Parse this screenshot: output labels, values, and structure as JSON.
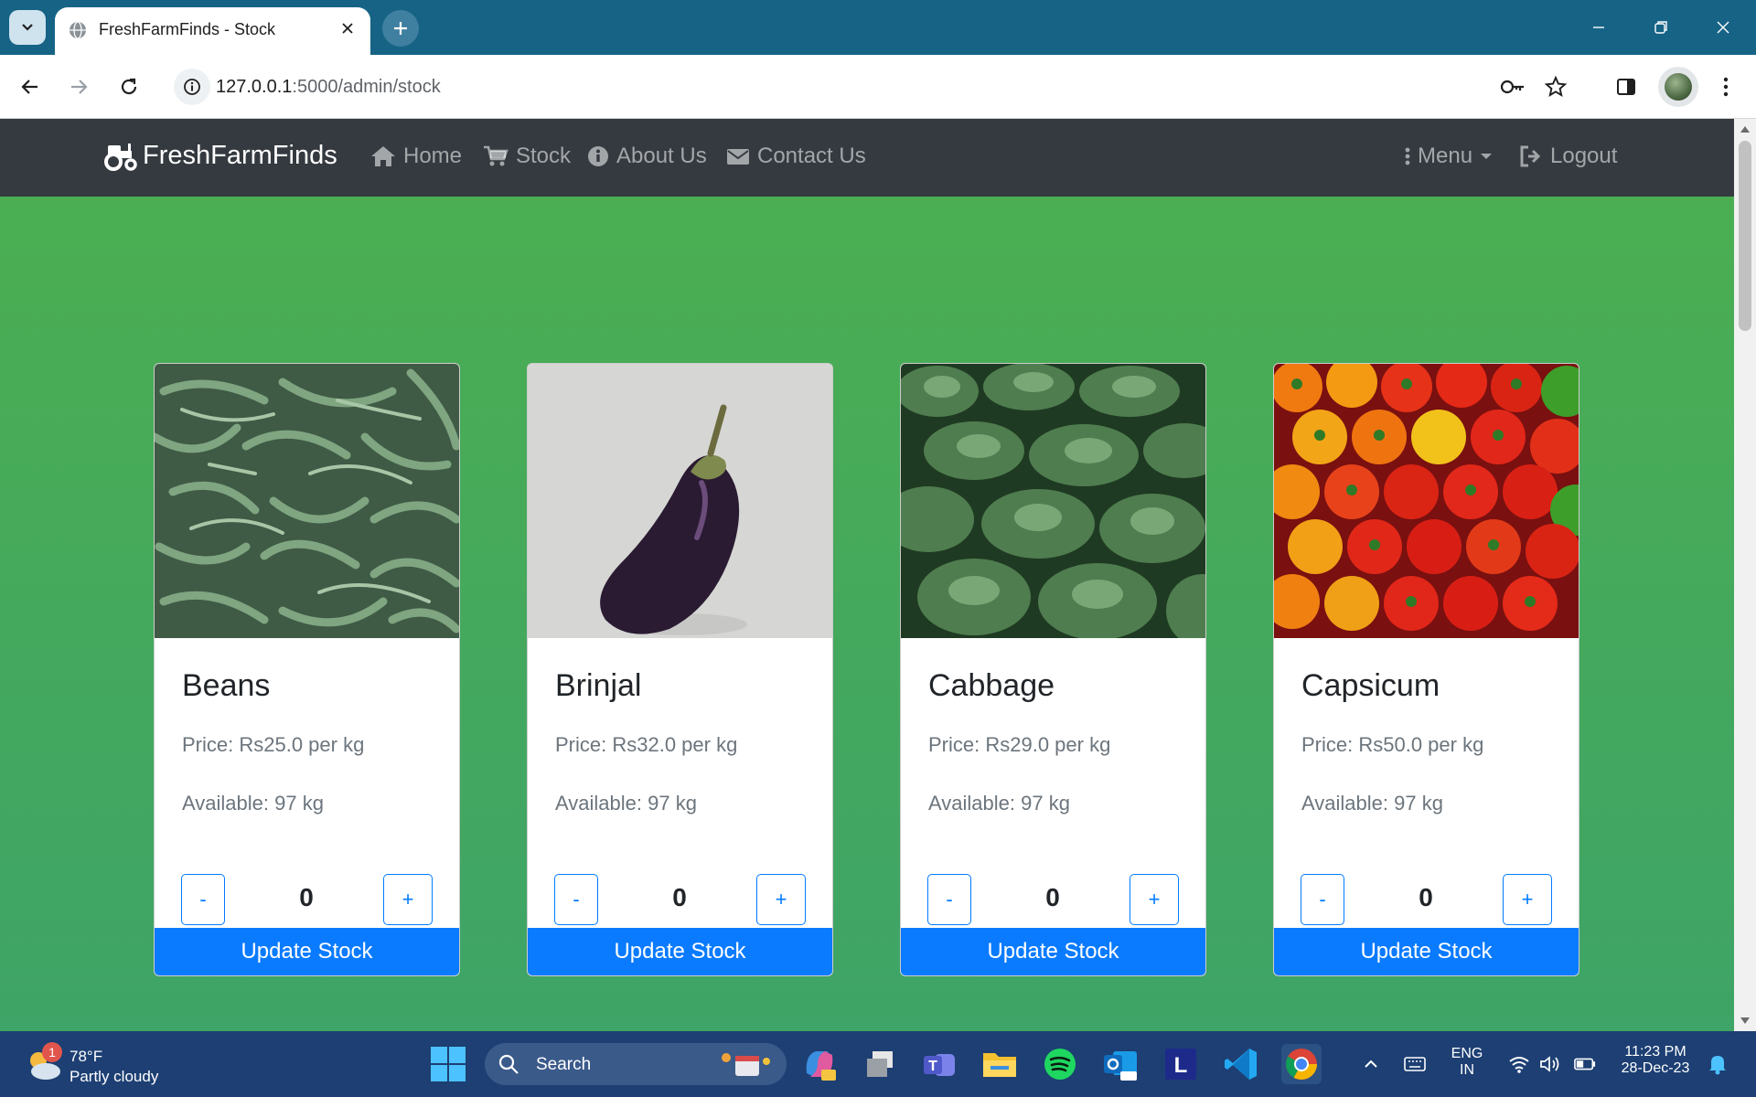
{
  "browser": {
    "tab_title": "FreshFarmFinds - Stock",
    "url_host": "127.0.0.1",
    "url_path": ":5000/admin/stock"
  },
  "navbar": {
    "brand": "FreshFarmFinds",
    "links": [
      {
        "label": "Home",
        "icon": "home-icon"
      },
      {
        "label": "Stock",
        "icon": "cart-icon"
      },
      {
        "label": "About Us",
        "icon": "info-icon"
      },
      {
        "label": "Contact Us",
        "icon": "envelope-icon"
      }
    ],
    "menu_label": "Menu",
    "logout_label": "Logout"
  },
  "products": [
    {
      "name": "Beans",
      "price": "Price: Rs25.0 per kg",
      "available": "Available: 97 kg",
      "quantity": "0",
      "minus": "-",
      "plus": "+",
      "button": "Update Stock"
    },
    {
      "name": "Brinjal",
      "price": "Price: Rs32.0 per kg",
      "available": "Available: 97 kg",
      "quantity": "0",
      "minus": "-",
      "plus": "+",
      "button": "Update Stock"
    },
    {
      "name": "Cabbage",
      "price": "Price: Rs29.0 per kg",
      "available": "Available: 97 kg",
      "quantity": "0",
      "minus": "-",
      "plus": "+",
      "button": "Update Stock"
    },
    {
      "name": "Capsicum",
      "price": "Price: Rs50.0 per kg",
      "available": "Available: 97 kg",
      "quantity": "0",
      "minus": "-",
      "plus": "+",
      "button": "Update Stock"
    }
  ],
  "taskbar": {
    "weather_temp": "78°F",
    "weather_desc": "Partly cloudy",
    "weather_badge": "1",
    "search_label": "Search",
    "lang_top": "ENG",
    "lang_bottom": "IN",
    "time": "11:23 PM",
    "date": "28-Dec-23"
  },
  "colors": {
    "navbar_bg": "#343a40",
    "page_bg": "#4caf50",
    "primary": "#007bff"
  }
}
